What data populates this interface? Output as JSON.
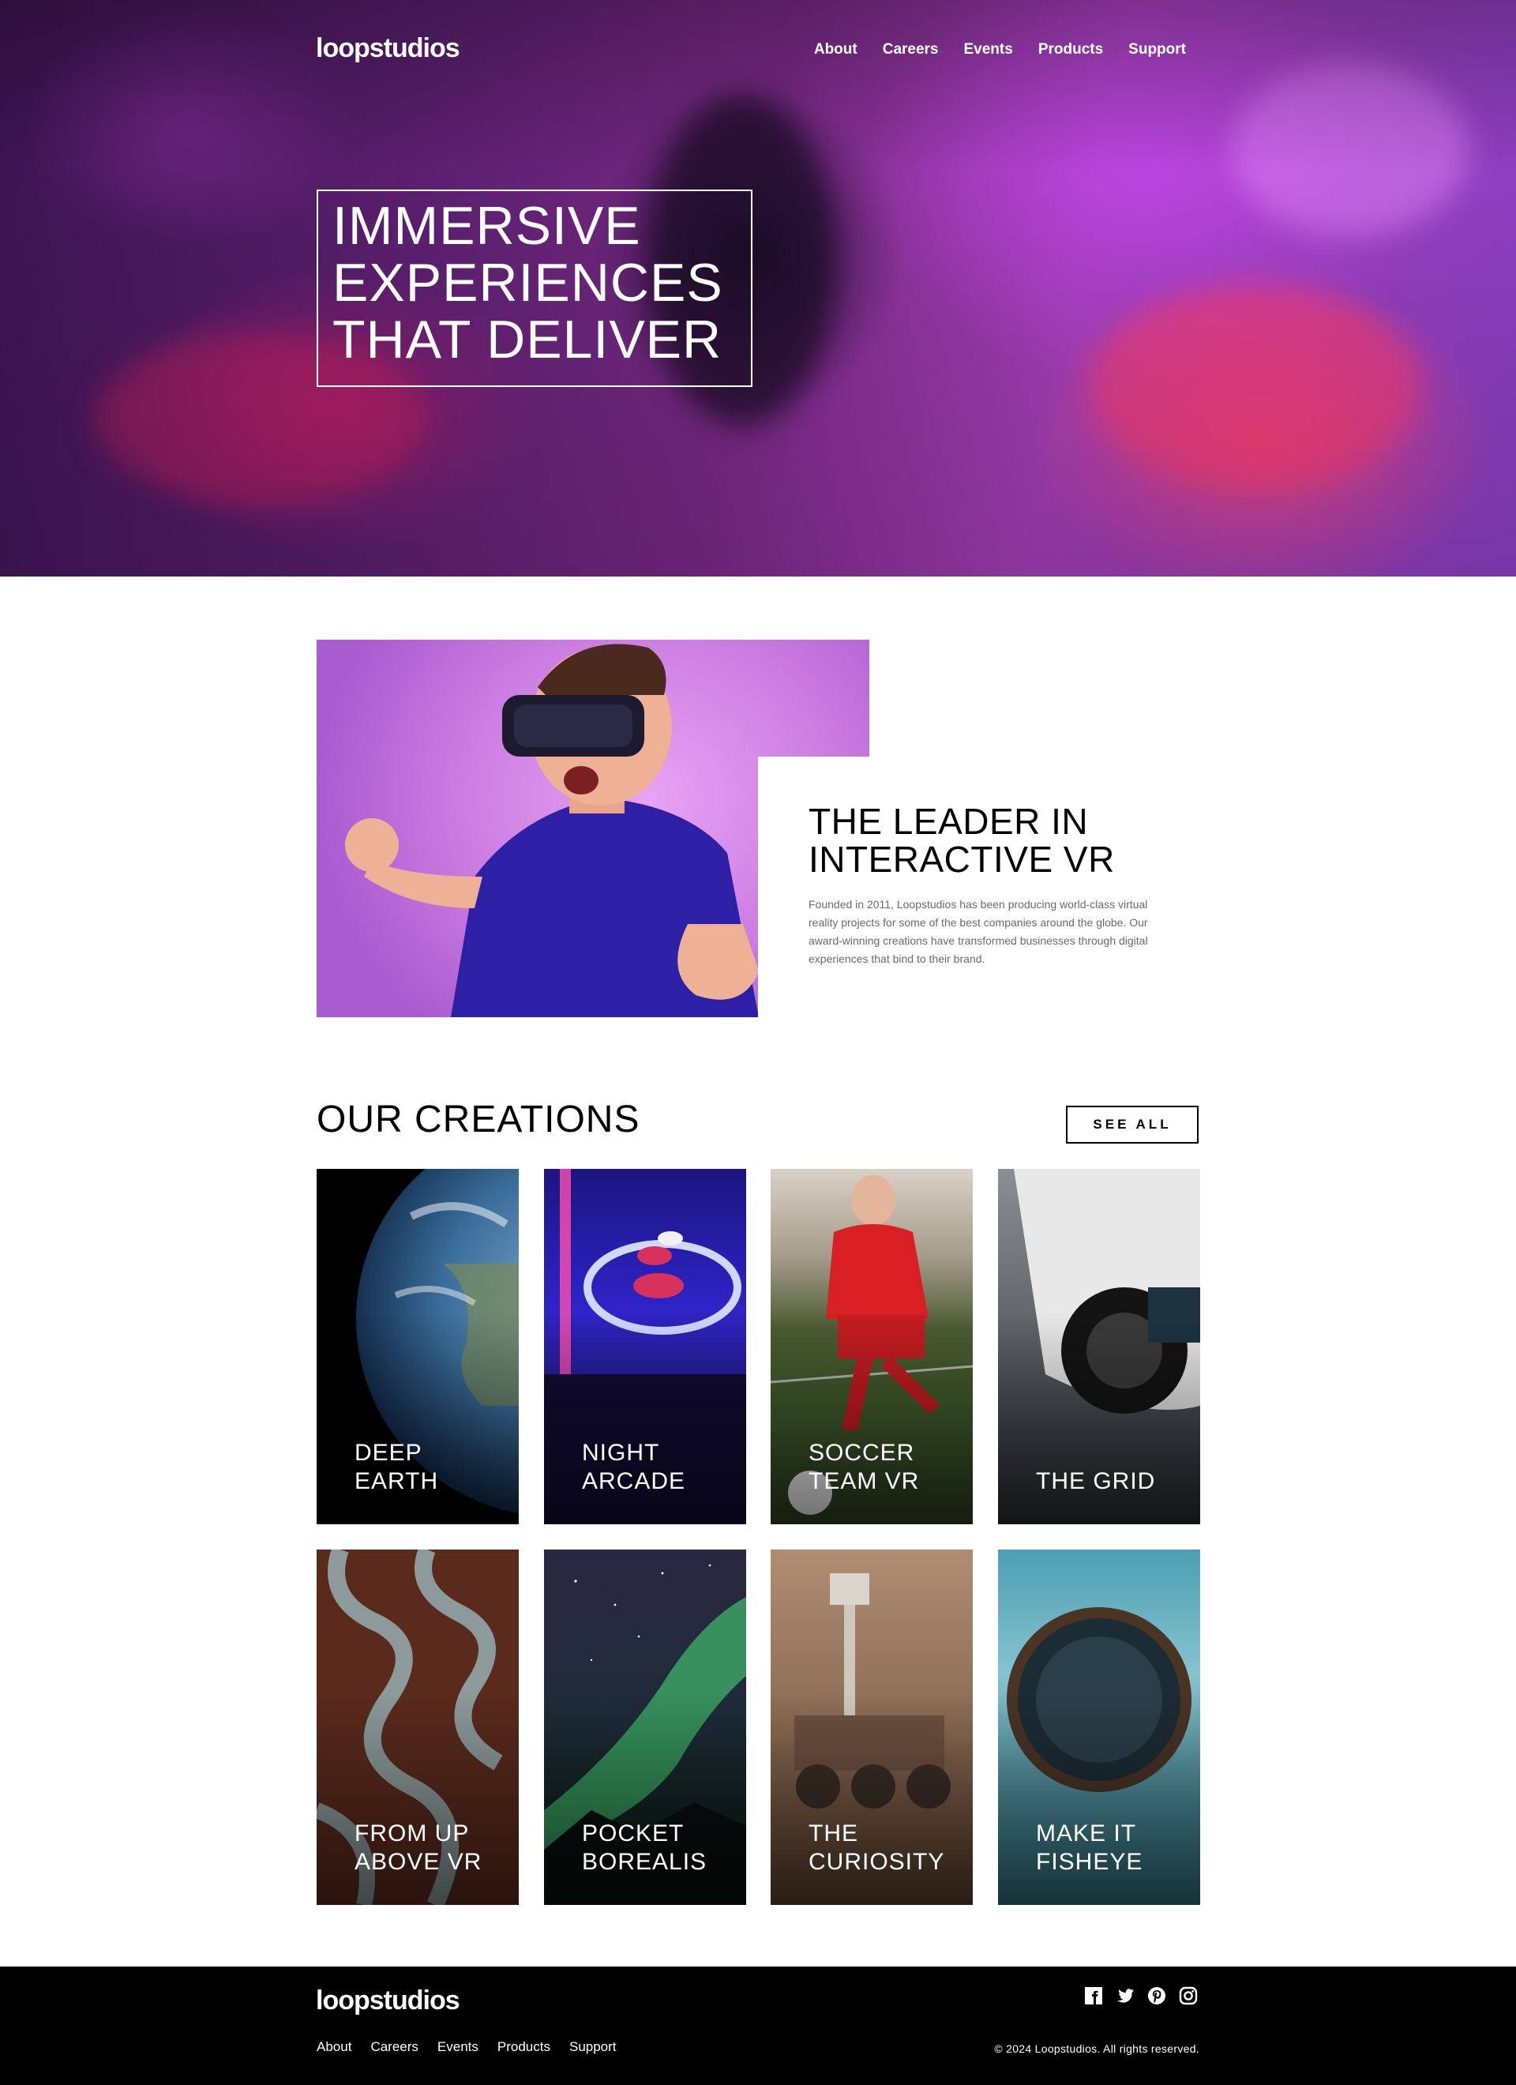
{
  "brand": {
    "logo": "loopstudios"
  },
  "nav": {
    "items": [
      {
        "label": "About"
      },
      {
        "label": "Careers"
      },
      {
        "label": "Events"
      },
      {
        "label": "Products"
      },
      {
        "label": "Support"
      }
    ]
  },
  "hero": {
    "headline_lines": [
      "IMMERSIVE",
      "EXPERIENCES",
      "THAT DELIVER"
    ]
  },
  "interactive": {
    "title_lines": [
      "THE LEADER IN",
      "INTERACTIVE VR"
    ],
    "body": "Founded in 2011, Loopstudios has been producing world-class virtual reality projects for some of the best companies around the globe. Our award-winning creations have transformed businesses through digital experiences that bind to their brand."
  },
  "creations": {
    "title": "OUR CREATIONS",
    "see_all_label": "SEE ALL",
    "items": [
      {
        "lines": [
          "DEEP",
          "EARTH"
        ]
      },
      {
        "lines": [
          "NIGHT",
          "ARCADE"
        ]
      },
      {
        "lines": [
          "SOCCER",
          "TEAM VR"
        ]
      },
      {
        "lines": [
          "THE GRID"
        ]
      },
      {
        "lines": [
          "FROM UP",
          "ABOVE VR"
        ]
      },
      {
        "lines": [
          "POCKET",
          "BOREALIS"
        ]
      },
      {
        "lines": [
          "THE",
          "CURIOSITY"
        ]
      },
      {
        "lines": [
          "MAKE IT",
          "FISHEYE"
        ]
      }
    ]
  },
  "footer": {
    "logo": "loopstudios",
    "copyright": "© 2024 Loopstudios. All rights reserved.",
    "social_icons": [
      "facebook-icon",
      "twitter-icon",
      "pinterest-icon",
      "instagram-icon"
    ]
  }
}
